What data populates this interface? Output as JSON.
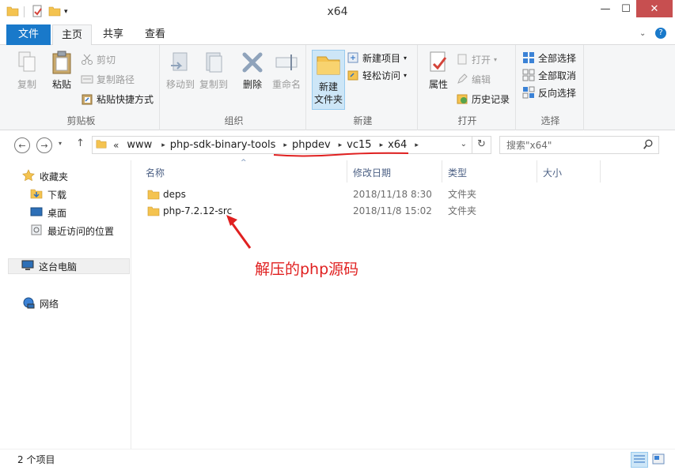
{
  "window": {
    "title": "x64"
  },
  "window_controls": {
    "minimize": "—",
    "maximize": "☐",
    "close": "✕"
  },
  "ribbon_tabs": {
    "file": "文件",
    "home": "主页",
    "share": "共享",
    "view": "查看"
  },
  "ribbon": {
    "clipboard": {
      "group_label": "剪贴板",
      "copy": "复制",
      "paste": "粘贴",
      "cut": "剪切",
      "copy_path": "复制路径",
      "paste_shortcut": "粘贴快捷方式"
    },
    "organize": {
      "group_label": "组织",
      "move_to": "移动到",
      "copy_to": "复制到",
      "delete": "删除",
      "rename": "重命名"
    },
    "new": {
      "group_label": "新建",
      "new_folder": "新建\n文件夹",
      "new_folder_line1": "新建",
      "new_folder_line2": "文件夹",
      "new_item": "新建项目",
      "easy_access": "轻松访问"
    },
    "open": {
      "group_label": "打开",
      "properties": "属性",
      "open": "打开",
      "edit": "编辑",
      "history": "历史记录"
    },
    "select": {
      "group_label": "选择",
      "select_all": "全部选择",
      "select_none": "全部取消",
      "invert": "反向选择"
    }
  },
  "address": {
    "overflow": "«",
    "crumbs": [
      "www",
      "php-sdk-binary-tools",
      "phpdev",
      "vc15",
      "x64"
    ]
  },
  "search": {
    "placeholder": "搜索\"x64\""
  },
  "nav_pane": {
    "favorites": "收藏夹",
    "downloads": "下载",
    "desktop": "桌面",
    "recent": "最近访问的位置",
    "this_pc": "这台电脑",
    "network": "网络"
  },
  "columns": {
    "name": "名称",
    "modified": "修改日期",
    "type": "类型",
    "size": "大小"
  },
  "files": [
    {
      "name": "deps",
      "modified": "2018/11/18 8:30",
      "type": "文件夹",
      "size": ""
    },
    {
      "name": "php-7.2.12-src",
      "modified": "2018/11/8 15:02",
      "type": "文件夹",
      "size": ""
    }
  ],
  "status": {
    "item_count": "2 个项目"
  },
  "annotation": {
    "text": "解压的php源码",
    "color": "#e02020"
  },
  "colors": {
    "accent": "#1979ca",
    "close": "#c74f50",
    "folder": "#f4c350",
    "annotation": "#e02020"
  }
}
